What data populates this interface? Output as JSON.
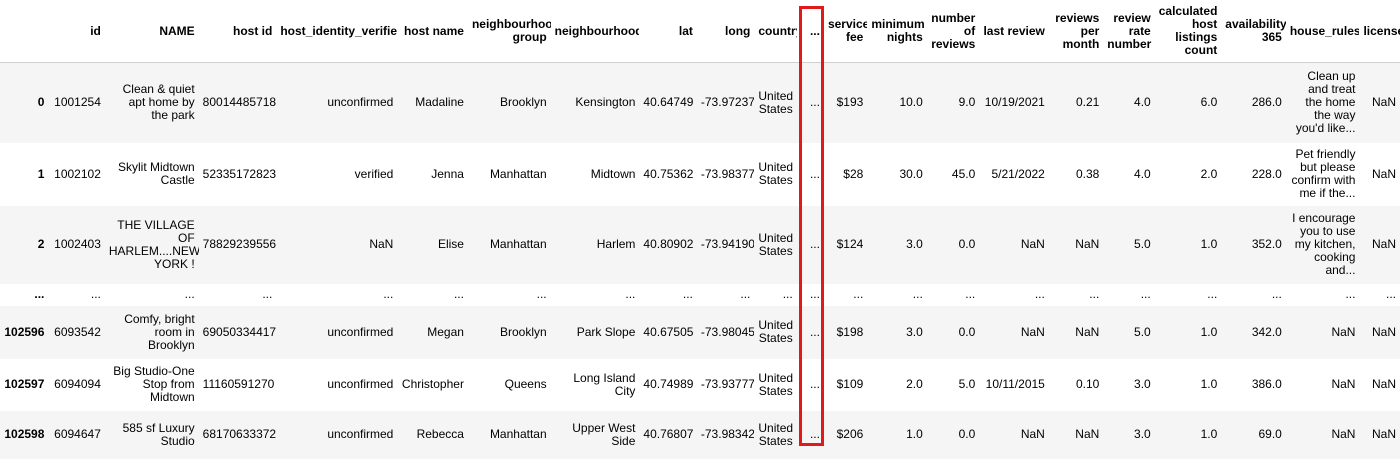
{
  "highlight_color": "#e01a1a",
  "columns": [
    "",
    "id",
    "NAME",
    "host id",
    "host_identity_verified",
    "host name",
    "neighbourhood group",
    "neighbourhood",
    "lat",
    "long",
    "country",
    "...",
    "service fee",
    "minimum nights",
    "number of reviews",
    "last review",
    "reviews per month",
    "review rate number",
    "calculated host listings count",
    "availability 365",
    "house_rules",
    "license"
  ],
  "rows": [
    {
      "index": "0",
      "cells": [
        "1001254",
        "Clean & quiet apt home by the park",
        "80014485718",
        "unconfirmed",
        "Madaline",
        "Brooklyn",
        "Kensington",
        "40.64749",
        "-73.97237",
        "United States",
        "...",
        "$193",
        "10.0",
        "9.0",
        "10/19/2021",
        "0.21",
        "4.0",
        "6.0",
        "286.0",
        "Clean up and treat the home the way you'd like...",
        "NaN"
      ]
    },
    {
      "index": "1",
      "cells": [
        "1002102",
        "Skylit Midtown Castle",
        "52335172823",
        "verified",
        "Jenna",
        "Manhattan",
        "Midtown",
        "40.75362",
        "-73.98377",
        "United States",
        "...",
        "$28",
        "30.0",
        "45.0",
        "5/21/2022",
        "0.38",
        "4.0",
        "2.0",
        "228.0",
        "Pet friendly but please confirm with me if the...",
        "NaN"
      ]
    },
    {
      "index": "2",
      "cells": [
        "1002403",
        "THE VILLAGE OF HARLEM....NEW YORK !",
        "78829239556",
        "NaN",
        "Elise",
        "Manhattan",
        "Harlem",
        "40.80902",
        "-73.94190",
        "United States",
        "...",
        "$124",
        "3.0",
        "0.0",
        "NaN",
        "NaN",
        "5.0",
        "1.0",
        "352.0",
        "I encourage you to use my kitchen, cooking and...",
        "NaN"
      ]
    },
    {
      "index": "...",
      "cells": [
        "...",
        "...",
        "...",
        "...",
        "...",
        "...",
        "...",
        "...",
        "...",
        "...",
        "...",
        "...",
        "...",
        "...",
        "...",
        "...",
        "...",
        "...",
        "...",
        "...",
        "..."
      ]
    },
    {
      "index": "102596",
      "cells": [
        "6093542",
        "Comfy, bright room in Brooklyn",
        "69050334417",
        "unconfirmed",
        "Megan",
        "Brooklyn",
        "Park Slope",
        "40.67505",
        "-73.98045",
        "United States",
        "...",
        "$198",
        "3.0",
        "0.0",
        "NaN",
        "NaN",
        "5.0",
        "1.0",
        "342.0",
        "NaN",
        "NaN"
      ]
    },
    {
      "index": "102597",
      "cells": [
        "6094094",
        "Big Studio-One Stop from Midtown",
        "11160591270",
        "unconfirmed",
        "Christopher",
        "Queens",
        "Long Island City",
        "40.74989",
        "-73.93777",
        "United States",
        "...",
        "$109",
        "2.0",
        "5.0",
        "10/11/2015",
        "0.10",
        "3.0",
        "1.0",
        "386.0",
        "NaN",
        "NaN"
      ]
    },
    {
      "index": "102598",
      "cells": [
        "6094647",
        "585 sf Luxury Studio",
        "68170633372",
        "unconfirmed",
        "Rebecca",
        "Manhattan",
        "Upper West Side",
        "40.76807",
        "-73.98342",
        "United States",
        "...",
        "$206",
        "1.0",
        "0.0",
        "NaN",
        "NaN",
        "3.0",
        "1.0",
        "69.0",
        "NaN",
        "NaN"
      ]
    }
  ]
}
